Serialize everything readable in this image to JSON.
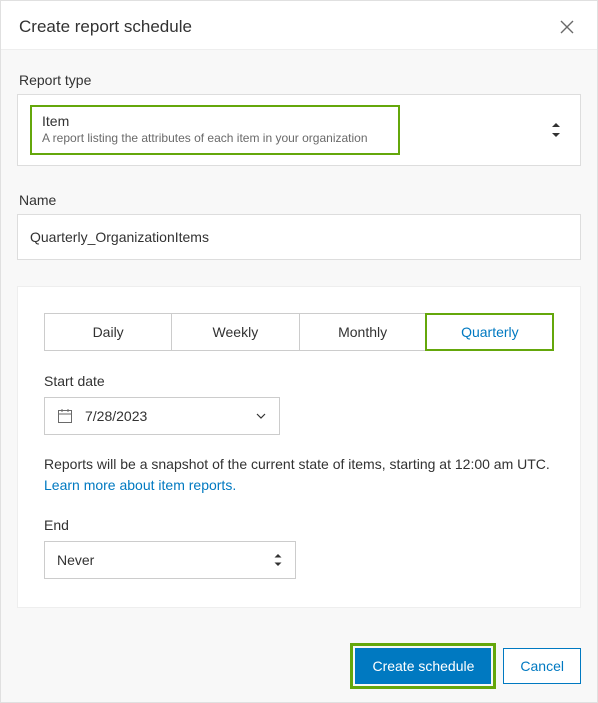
{
  "header": {
    "title": "Create report schedule"
  },
  "reportType": {
    "label": "Report type",
    "selectedTitle": "Item",
    "selectedDescription": "A report listing the attributes of each item in your organization"
  },
  "name": {
    "label": "Name",
    "value": "Quarterly_OrganizationItems"
  },
  "schedule": {
    "tabs": [
      "Daily",
      "Weekly",
      "Monthly",
      "Quarterly"
    ],
    "activeIndex": 3,
    "startDateLabel": "Start date",
    "startDateValue": "7/28/2023",
    "infoText": "Reports will be a snapshot of the current state of items, starting at 12:00 am UTC.",
    "learnMore": "Learn more about item reports.",
    "endLabel": "End",
    "endValue": "Never"
  },
  "footer": {
    "primary": "Create schedule",
    "cancel": "Cancel"
  }
}
